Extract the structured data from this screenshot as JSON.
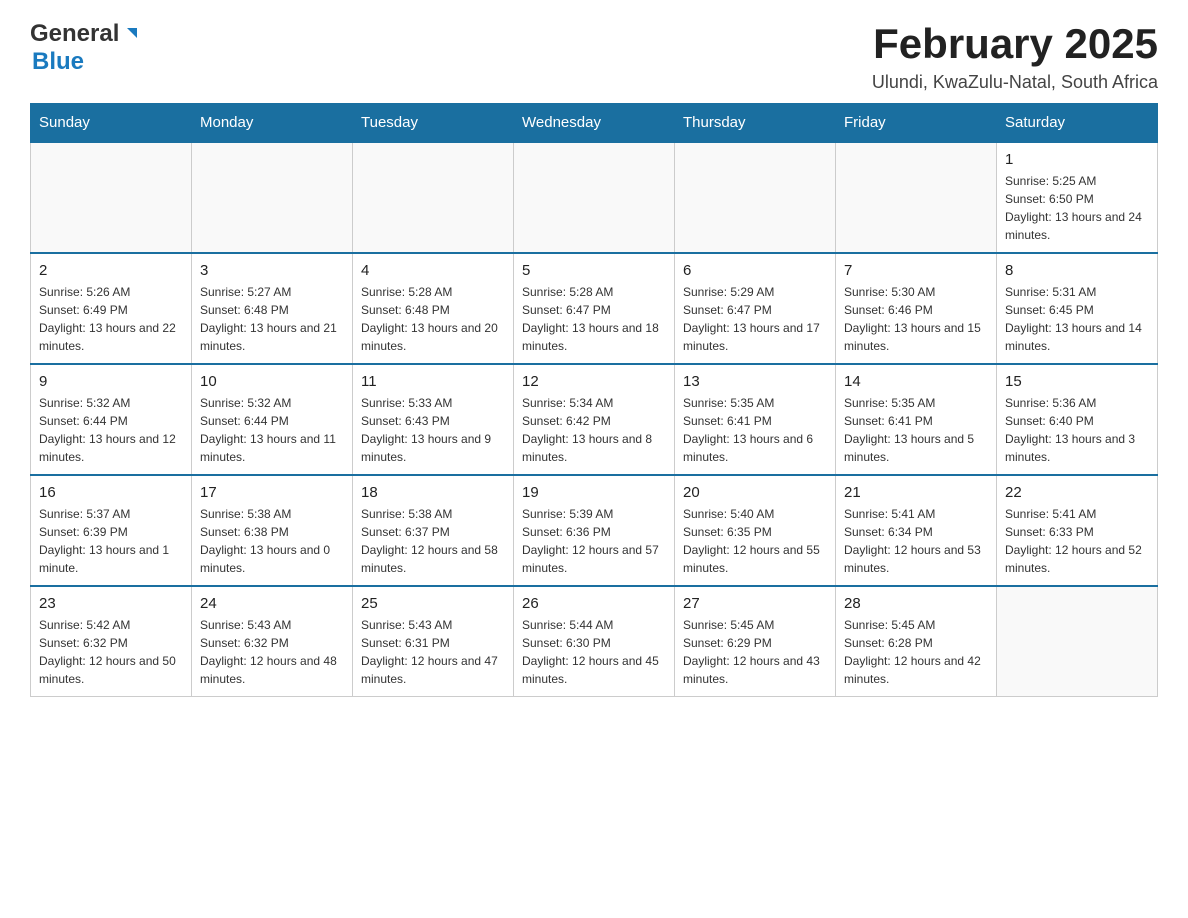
{
  "header": {
    "logo_general": "General",
    "logo_blue": "Blue",
    "month_title": "February 2025",
    "location": "Ulundi, KwaZulu-Natal, South Africa"
  },
  "weekdays": [
    "Sunday",
    "Monday",
    "Tuesday",
    "Wednesday",
    "Thursday",
    "Friday",
    "Saturday"
  ],
  "weeks": [
    [
      {
        "day": "",
        "info": ""
      },
      {
        "day": "",
        "info": ""
      },
      {
        "day": "",
        "info": ""
      },
      {
        "day": "",
        "info": ""
      },
      {
        "day": "",
        "info": ""
      },
      {
        "day": "",
        "info": ""
      },
      {
        "day": "1",
        "info": "Sunrise: 5:25 AM\nSunset: 6:50 PM\nDaylight: 13 hours and 24 minutes."
      }
    ],
    [
      {
        "day": "2",
        "info": "Sunrise: 5:26 AM\nSunset: 6:49 PM\nDaylight: 13 hours and 22 minutes."
      },
      {
        "day": "3",
        "info": "Sunrise: 5:27 AM\nSunset: 6:48 PM\nDaylight: 13 hours and 21 minutes."
      },
      {
        "day": "4",
        "info": "Sunrise: 5:28 AM\nSunset: 6:48 PM\nDaylight: 13 hours and 20 minutes."
      },
      {
        "day": "5",
        "info": "Sunrise: 5:28 AM\nSunset: 6:47 PM\nDaylight: 13 hours and 18 minutes."
      },
      {
        "day": "6",
        "info": "Sunrise: 5:29 AM\nSunset: 6:47 PM\nDaylight: 13 hours and 17 minutes."
      },
      {
        "day": "7",
        "info": "Sunrise: 5:30 AM\nSunset: 6:46 PM\nDaylight: 13 hours and 15 minutes."
      },
      {
        "day": "8",
        "info": "Sunrise: 5:31 AM\nSunset: 6:45 PM\nDaylight: 13 hours and 14 minutes."
      }
    ],
    [
      {
        "day": "9",
        "info": "Sunrise: 5:32 AM\nSunset: 6:44 PM\nDaylight: 13 hours and 12 minutes."
      },
      {
        "day": "10",
        "info": "Sunrise: 5:32 AM\nSunset: 6:44 PM\nDaylight: 13 hours and 11 minutes."
      },
      {
        "day": "11",
        "info": "Sunrise: 5:33 AM\nSunset: 6:43 PM\nDaylight: 13 hours and 9 minutes."
      },
      {
        "day": "12",
        "info": "Sunrise: 5:34 AM\nSunset: 6:42 PM\nDaylight: 13 hours and 8 minutes."
      },
      {
        "day": "13",
        "info": "Sunrise: 5:35 AM\nSunset: 6:41 PM\nDaylight: 13 hours and 6 minutes."
      },
      {
        "day": "14",
        "info": "Sunrise: 5:35 AM\nSunset: 6:41 PM\nDaylight: 13 hours and 5 minutes."
      },
      {
        "day": "15",
        "info": "Sunrise: 5:36 AM\nSunset: 6:40 PM\nDaylight: 13 hours and 3 minutes."
      }
    ],
    [
      {
        "day": "16",
        "info": "Sunrise: 5:37 AM\nSunset: 6:39 PM\nDaylight: 13 hours and 1 minute."
      },
      {
        "day": "17",
        "info": "Sunrise: 5:38 AM\nSunset: 6:38 PM\nDaylight: 13 hours and 0 minutes."
      },
      {
        "day": "18",
        "info": "Sunrise: 5:38 AM\nSunset: 6:37 PM\nDaylight: 12 hours and 58 minutes."
      },
      {
        "day": "19",
        "info": "Sunrise: 5:39 AM\nSunset: 6:36 PM\nDaylight: 12 hours and 57 minutes."
      },
      {
        "day": "20",
        "info": "Sunrise: 5:40 AM\nSunset: 6:35 PM\nDaylight: 12 hours and 55 minutes."
      },
      {
        "day": "21",
        "info": "Sunrise: 5:41 AM\nSunset: 6:34 PM\nDaylight: 12 hours and 53 minutes."
      },
      {
        "day": "22",
        "info": "Sunrise: 5:41 AM\nSunset: 6:33 PM\nDaylight: 12 hours and 52 minutes."
      }
    ],
    [
      {
        "day": "23",
        "info": "Sunrise: 5:42 AM\nSunset: 6:32 PM\nDaylight: 12 hours and 50 minutes."
      },
      {
        "day": "24",
        "info": "Sunrise: 5:43 AM\nSunset: 6:32 PM\nDaylight: 12 hours and 48 minutes."
      },
      {
        "day": "25",
        "info": "Sunrise: 5:43 AM\nSunset: 6:31 PM\nDaylight: 12 hours and 47 minutes."
      },
      {
        "day": "26",
        "info": "Sunrise: 5:44 AM\nSunset: 6:30 PM\nDaylight: 12 hours and 45 minutes."
      },
      {
        "day": "27",
        "info": "Sunrise: 5:45 AM\nSunset: 6:29 PM\nDaylight: 12 hours and 43 minutes."
      },
      {
        "day": "28",
        "info": "Sunrise: 5:45 AM\nSunset: 6:28 PM\nDaylight: 12 hours and 42 minutes."
      },
      {
        "day": "",
        "info": ""
      }
    ]
  ]
}
